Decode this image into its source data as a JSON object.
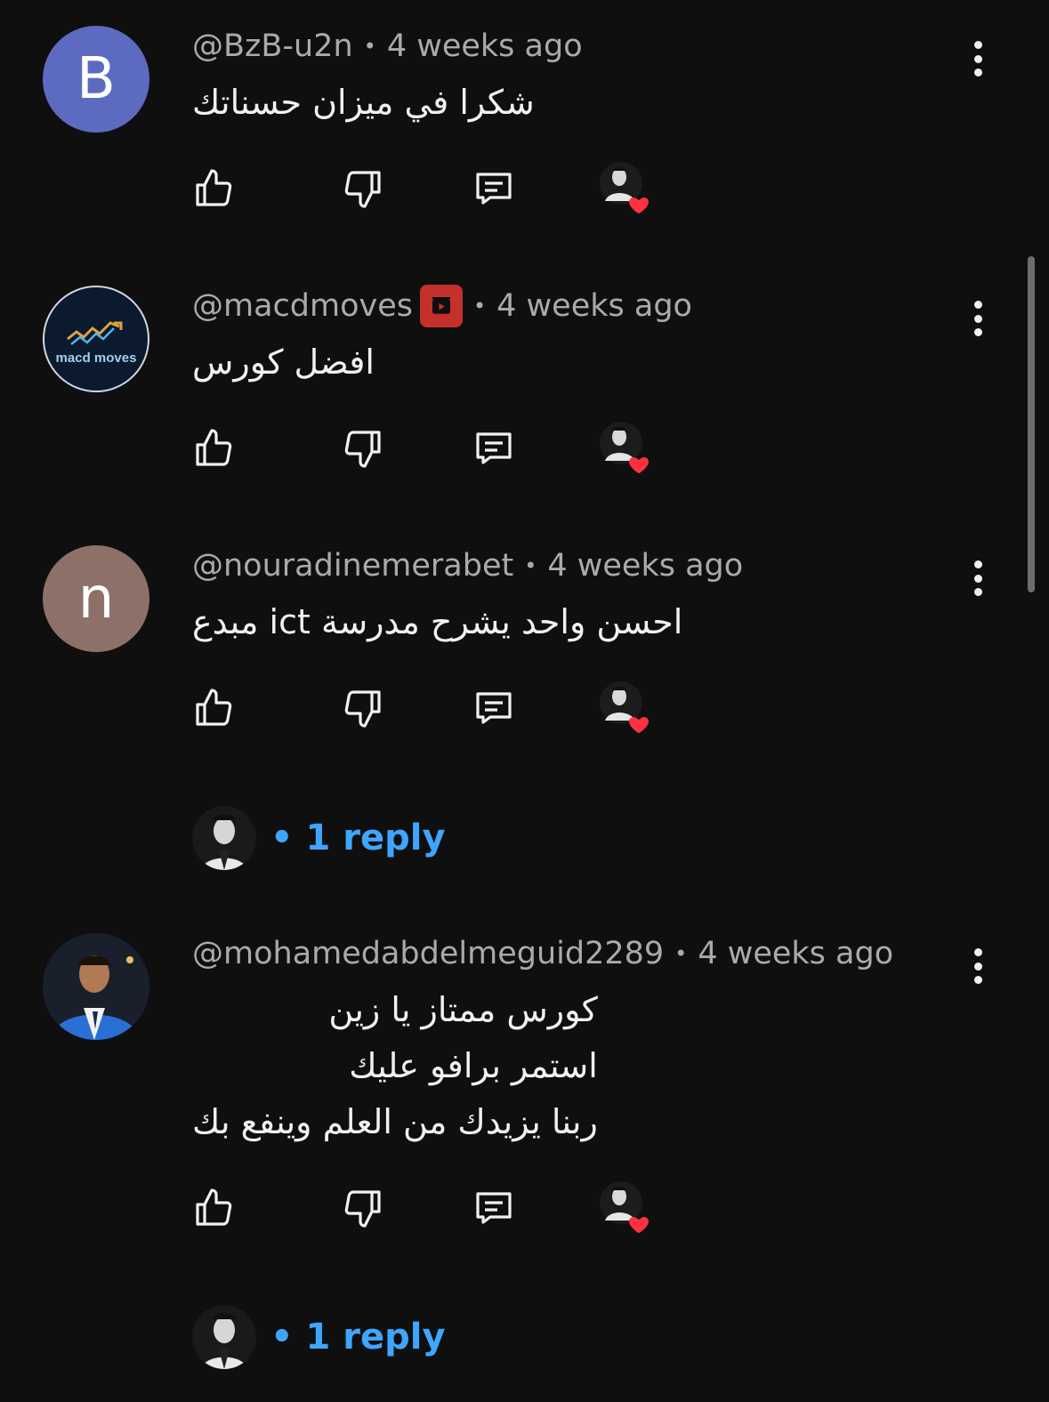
{
  "comments": [
    {
      "handle": "@BzB-u2n",
      "time": "4 weeks ago",
      "text": "شكرا في ميزان حسناتك",
      "avatar_letter": "B",
      "avatar_color": "#5c6bc0"
    },
    {
      "handle": "@macdmoves",
      "time": "4 weeks ago",
      "text": "افضل كورس",
      "avatar_logo_text": "macd moves",
      "has_channel_badge": true
    },
    {
      "handle": "@nouradinemerabet",
      "time": "4 weeks ago",
      "text": "احسن واحد يشرح مدرسة ict مبدع",
      "avatar_letter": "n",
      "avatar_color": "#8d7168",
      "reply_label": "1 reply"
    },
    {
      "handle": "@mohamedabdelmeguid2289",
      "time": "4 weeks ago",
      "text": "كورس ممتاز يا زين\nاستمر برافو عليك\nربنا يزيدك من العلم وينفع بك",
      "avatar": "photo",
      "reply_label": "1 reply"
    }
  ],
  "separator": "•",
  "colors": {
    "background": "#0f0f0f",
    "meta_text": "#aaaaaa",
    "body_text": "#f1f1f1",
    "reply_link": "#3ea6ff",
    "heart": "#ff3040"
  },
  "icons": [
    "like-icon",
    "dislike-icon",
    "reply-icon",
    "creator-heart-icon",
    "more-vert-icon"
  ]
}
